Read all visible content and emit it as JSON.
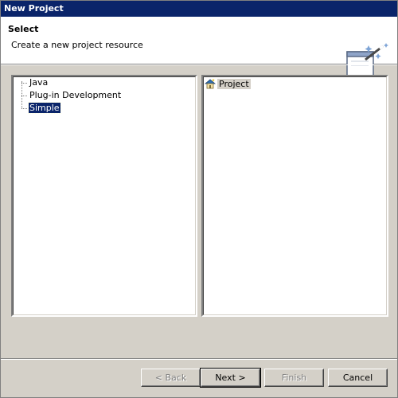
{
  "window": {
    "title": "New Project"
  },
  "banner": {
    "title": "Select",
    "description": "Create a new project resource"
  },
  "tree": {
    "items": [
      {
        "label": "Java",
        "selected": false
      },
      {
        "label": "Plug-in Development",
        "selected": false
      },
      {
        "label": "Simple",
        "selected": true
      }
    ]
  },
  "list": {
    "items": [
      {
        "label": "Project",
        "icon": "project-icon"
      }
    ]
  },
  "buttons": {
    "back": "< Back",
    "next": "Next >",
    "finish": "Finish",
    "cancel": "Cancel"
  },
  "colors": {
    "titlebar": "#0a246a",
    "selection": "#0a246a",
    "face": "#d4d0c8"
  }
}
